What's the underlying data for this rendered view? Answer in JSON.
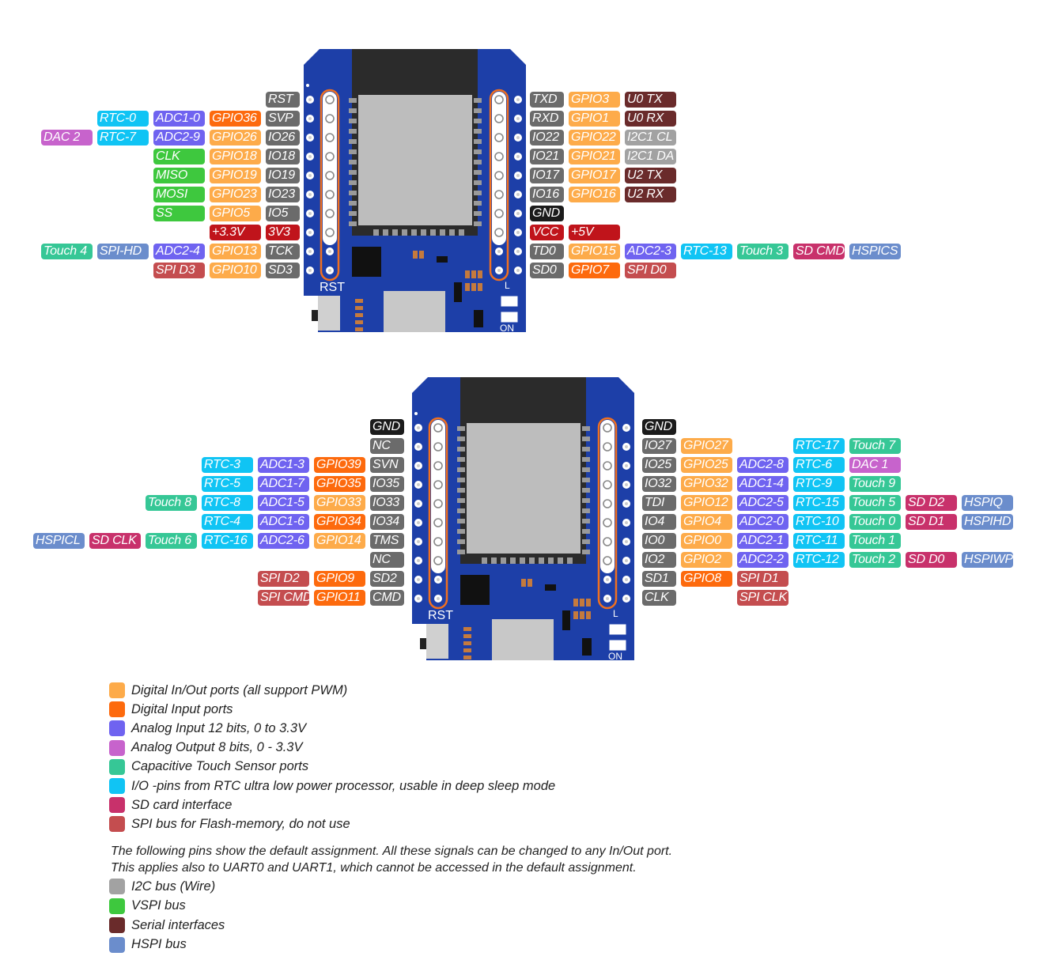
{
  "colors": {
    "name": "#6b6b6b",
    "gnd": "#1b1b1b",
    "pwr": "#c0141b",
    "gpio": "#fdab4a",
    "din": "#fd6a0d",
    "adc": "#6f63f0",
    "dac": "#c763cc",
    "touch": "#36c796",
    "rtc": "#10c4f4",
    "sd": "#c8316b",
    "flash": "#c44d4f",
    "i2c": "#a2a2a2",
    "vspi": "#3ec83e",
    "serial": "#6a2b2b",
    "hspi": "#6b8dcc",
    "board": "#1d3fa8",
    "highlight": "#f07020"
  },
  "boards": [
    {
      "silk": {
        "rst": "RST",
        "led": "L",
        "on": "ON"
      },
      "left_rows": [
        [
          {
            "t": "RST",
            "c": "name"
          }
        ],
        [
          {
            "t": "SVP",
            "c": "name"
          },
          {
            "t": "GPIO36",
            "c": "din"
          },
          {
            "t": "ADC1-0",
            "c": "adc"
          },
          {
            "t": "RTC-0",
            "c": "rtc"
          }
        ],
        [
          {
            "t": "IO26",
            "c": "name"
          },
          {
            "t": "GPIO26",
            "c": "gpio"
          },
          {
            "t": "ADC2-9",
            "c": "adc"
          },
          {
            "t": "RTC-7",
            "c": "rtc"
          },
          {
            "t": "DAC 2",
            "c": "dac"
          }
        ],
        [
          {
            "t": "IO18",
            "c": "name"
          },
          {
            "t": "GPIO18",
            "c": "gpio"
          },
          {
            "t": "CLK",
            "c": "vspi"
          }
        ],
        [
          {
            "t": "IO19",
            "c": "name"
          },
          {
            "t": "GPIO19",
            "c": "gpio"
          },
          {
            "t": "MISO",
            "c": "vspi"
          }
        ],
        [
          {
            "t": "IO23",
            "c": "name"
          },
          {
            "t": "GPIO23",
            "c": "gpio"
          },
          {
            "t": "MOSI",
            "c": "vspi"
          }
        ],
        [
          {
            "t": "IO5",
            "c": "name"
          },
          {
            "t": "GPIO5",
            "c": "gpio"
          },
          {
            "t": "SS",
            "c": "vspi"
          }
        ],
        [
          {
            "t": "3V3",
            "c": "pwr"
          },
          {
            "t": "+3.3V",
            "c": "pwr"
          }
        ],
        [
          {
            "t": "TCK",
            "c": "name"
          },
          {
            "t": "GPIO13",
            "c": "gpio"
          },
          {
            "t": "ADC2-4",
            "c": "adc"
          },
          {
            "t": "SPI-HD",
            "c": "hspi"
          },
          {
            "t": "Touch 4",
            "c": "touch"
          }
        ],
        [
          {
            "t": "SD3",
            "c": "name"
          },
          {
            "t": "GPIO10",
            "c": "gpio"
          },
          {
            "t": "SPI D3",
            "c": "flash"
          }
        ]
      ],
      "right_rows": [
        [
          {
            "t": "TXD",
            "c": "name"
          },
          {
            "t": "GPIO3",
            "c": "gpio"
          },
          {
            "t": "U0 TX",
            "c": "serial"
          }
        ],
        [
          {
            "t": "RXD",
            "c": "name"
          },
          {
            "t": "GPIO1",
            "c": "gpio"
          },
          {
            "t": "U0 RX",
            "c": "serial"
          }
        ],
        [
          {
            "t": "IO22",
            "c": "name"
          },
          {
            "t": "GPIO22",
            "c": "gpio"
          },
          {
            "t": "I2C1 CL",
            "c": "i2c"
          }
        ],
        [
          {
            "t": "IO21",
            "c": "name"
          },
          {
            "t": "GPIO21",
            "c": "gpio"
          },
          {
            "t": "I2C1 DA",
            "c": "i2c"
          }
        ],
        [
          {
            "t": "IO17",
            "c": "name"
          },
          {
            "t": "GPIO17",
            "c": "gpio"
          },
          {
            "t": "U2 TX",
            "c": "serial"
          }
        ],
        [
          {
            "t": "IO16",
            "c": "name"
          },
          {
            "t": "GPIO16",
            "c": "gpio"
          },
          {
            "t": "U2 RX",
            "c": "serial"
          }
        ],
        [
          {
            "t": "GND",
            "c": "gnd"
          }
        ],
        [
          {
            "t": "VCC",
            "c": "pwr"
          },
          {
            "t": "+5V",
            "c": "pwr"
          }
        ],
        [
          {
            "t": "TD0",
            "c": "name"
          },
          {
            "t": "GPIO15",
            "c": "gpio"
          },
          {
            "t": "ADC2-3",
            "c": "adc"
          },
          {
            "t": "RTC-13",
            "c": "rtc"
          },
          {
            "t": "Touch 3",
            "c": "touch"
          },
          {
            "t": "SD CMD",
            "c": "sd"
          },
          {
            "t": "HSPICS",
            "c": "hspi"
          }
        ],
        [
          {
            "t": "SD0",
            "c": "name"
          },
          {
            "t": "GPIO7",
            "c": "din"
          },
          {
            "t": "SPI D0",
            "c": "flash"
          }
        ]
      ]
    },
    {
      "silk": {
        "rst": "RST",
        "led": "L",
        "on": "ON"
      },
      "left_rows": [
        [
          {
            "t": "GND",
            "c": "gnd"
          }
        ],
        [
          {
            "t": "NC",
            "c": "name"
          }
        ],
        [
          {
            "t": "SVN",
            "c": "name"
          },
          {
            "t": "GPIO39",
            "c": "din"
          },
          {
            "t": "ADC1-3",
            "c": "adc"
          },
          {
            "t": "RTC-3",
            "c": "rtc"
          }
        ],
        [
          {
            "t": "IO35",
            "c": "name"
          },
          {
            "t": "GPIO35",
            "c": "din"
          },
          {
            "t": "ADC1-7",
            "c": "adc"
          },
          {
            "t": "RTC-5",
            "c": "rtc"
          }
        ],
        [
          {
            "t": "IO33",
            "c": "name"
          },
          {
            "t": "GPIO33",
            "c": "gpio"
          },
          {
            "t": "ADC1-5",
            "c": "adc"
          },
          {
            "t": "RTC-8",
            "c": "rtc"
          },
          {
            "t": "Touch 8",
            "c": "touch"
          }
        ],
        [
          {
            "t": "IO34",
            "c": "name"
          },
          {
            "t": "GPIO34",
            "c": "din"
          },
          {
            "t": "ADC1-6",
            "c": "adc"
          },
          {
            "t": "RTC-4",
            "c": "rtc"
          }
        ],
        [
          {
            "t": "TMS",
            "c": "name"
          },
          {
            "t": "GPIO14",
            "c": "gpio"
          },
          {
            "t": "ADC2-6",
            "c": "adc"
          },
          {
            "t": "RTC-16",
            "c": "rtc"
          },
          {
            "t": "Touch 6",
            "c": "touch"
          },
          {
            "t": "SD CLK",
            "c": "sd"
          },
          {
            "t": "HSPICL",
            "c": "hspi"
          }
        ],
        [
          {
            "t": "NC",
            "c": "name"
          }
        ],
        [
          {
            "t": "SD2",
            "c": "name"
          },
          {
            "t": "GPIO9",
            "c": "din"
          },
          {
            "t": "SPI D2",
            "c": "flash"
          }
        ],
        [
          {
            "t": "CMD",
            "c": "name"
          },
          {
            "t": "GPIO11",
            "c": "din"
          },
          {
            "t": "SPI CMD",
            "c": "flash"
          }
        ]
      ],
      "right_rows": [
        [
          {
            "t": "GND",
            "c": "gnd"
          }
        ],
        [
          {
            "t": "IO27",
            "c": "name"
          },
          {
            "t": "GPIO27",
            "c": "gpio"
          },
          null,
          {
            "t": "RTC-17",
            "c": "rtc"
          },
          {
            "t": "Touch 7",
            "c": "touch"
          }
        ],
        [
          {
            "t": "IO25",
            "c": "name"
          },
          {
            "t": "GPIO25",
            "c": "gpio"
          },
          {
            "t": "ADC2-8",
            "c": "adc"
          },
          {
            "t": "RTC-6",
            "c": "rtc"
          },
          {
            "t": "DAC 1",
            "c": "dac"
          }
        ],
        [
          {
            "t": "IO32",
            "c": "name"
          },
          {
            "t": "GPIO32",
            "c": "gpio"
          },
          {
            "t": "ADC1-4",
            "c": "adc"
          },
          {
            "t": "RTC-9",
            "c": "rtc"
          },
          {
            "t": "Touch 9",
            "c": "touch"
          }
        ],
        [
          {
            "t": "TDI",
            "c": "name"
          },
          {
            "t": "GPIO12",
            "c": "gpio"
          },
          {
            "t": "ADC2-5",
            "c": "adc"
          },
          {
            "t": "RTC-15",
            "c": "rtc"
          },
          {
            "t": "Touch 5",
            "c": "touch"
          },
          {
            "t": "SD D2",
            "c": "sd"
          },
          {
            "t": "HSPIQ",
            "c": "hspi"
          }
        ],
        [
          {
            "t": "IO4",
            "c": "name"
          },
          {
            "t": "GPIO4",
            "c": "gpio"
          },
          {
            "t": "ADC2-0",
            "c": "adc"
          },
          {
            "t": "RTC-10",
            "c": "rtc"
          },
          {
            "t": "Touch 0",
            "c": "touch"
          },
          {
            "t": "SD D1",
            "c": "sd"
          },
          {
            "t": "HSPIHD",
            "c": "hspi"
          }
        ],
        [
          {
            "t": "IO0",
            "c": "name"
          },
          {
            "t": "GPIO0",
            "c": "gpio"
          },
          {
            "t": "ADC2-1",
            "c": "adc"
          },
          {
            "t": "RTC-11",
            "c": "rtc"
          },
          {
            "t": "Touch 1",
            "c": "touch"
          }
        ],
        [
          {
            "t": "IO2",
            "c": "name"
          },
          {
            "t": "GPIO2",
            "c": "gpio"
          },
          {
            "t": "ADC2-2",
            "c": "adc"
          },
          {
            "t": "RTC-12",
            "c": "rtc"
          },
          {
            "t": "Touch 2",
            "c": "touch"
          },
          {
            "t": "SD D0",
            "c": "sd"
          },
          {
            "t": "HSPIWP",
            "c": "hspi"
          }
        ],
        [
          {
            "t": "SD1",
            "c": "name"
          },
          {
            "t": "GPIO8",
            "c": "din"
          },
          {
            "t": "SPI D1",
            "c": "flash"
          }
        ],
        [
          {
            "t": "CLK",
            "c": "name"
          },
          null,
          {
            "t": "SPI CLK",
            "c": "flash"
          }
        ]
      ]
    }
  ],
  "legend": {
    "items": [
      {
        "c": "gpio",
        "text": "Digital In/Out ports (all support PWM)"
      },
      {
        "c": "din",
        "text": "Digital Input ports"
      },
      {
        "c": "adc",
        "text": "Analog Input 12 bits, 0 to 3.3V"
      },
      {
        "c": "dac",
        "text": "Analog Output 8 bits, 0 - 3.3V"
      },
      {
        "c": "touch",
        "text": "Capacitive Touch Sensor ports"
      },
      {
        "c": "rtc",
        "text": "I/O -pins from RTC ultra low power processor, usable in deep sleep mode"
      },
      {
        "c": "sd",
        "text": "SD card interface"
      },
      {
        "c": "flash",
        "text": "SPI bus for Flash-memory, do not use"
      }
    ],
    "note_line1": "The following pins show the default assignment. All these signals can be changed to any In/Out port.",
    "note_line2": "This applies also to UART0 and UART1, which cannot be accessed in the default assignment.",
    "default_items": [
      {
        "c": "i2c",
        "text": "I2C bus (Wire)"
      },
      {
        "c": "vspi",
        "text": "VSPI bus"
      },
      {
        "c": "serial",
        "text": "Serial interfaces"
      },
      {
        "c": "hspi",
        "text": "HSPI bus"
      }
    ]
  }
}
